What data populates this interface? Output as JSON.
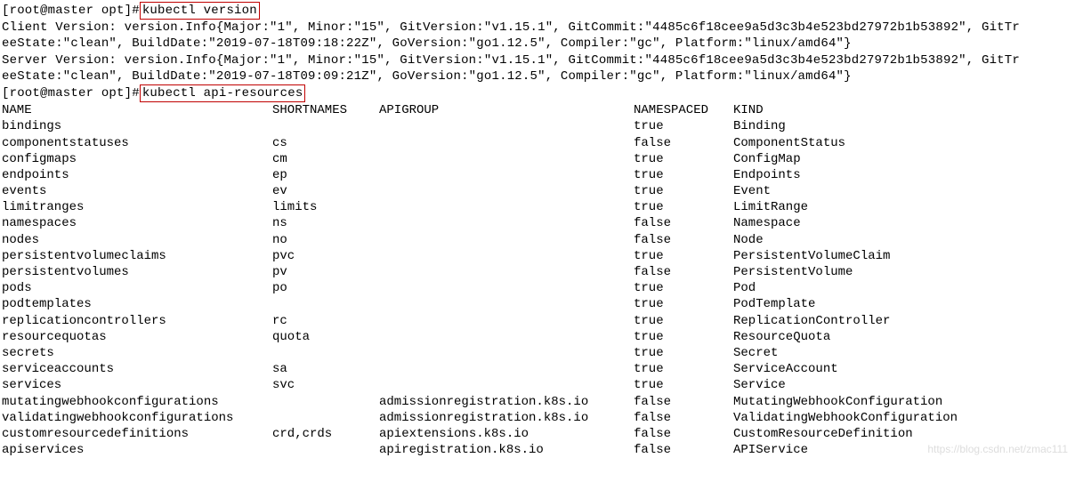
{
  "prompt1": {
    "prefix": "[root@master opt]#",
    "command": "kubectl version"
  },
  "version_output": [
    "Client Version: version.Info{Major:\"1\", Minor:\"15\", GitVersion:\"v1.15.1\", GitCommit:\"4485c6f18cee9a5d3c3b4e523bd27972b1b53892\", GitTr",
    "eeState:\"clean\", BuildDate:\"2019-07-18T09:18:22Z\", GoVersion:\"go1.12.5\", Compiler:\"gc\", Platform:\"linux/amd64\"}",
    "Server Version: version.Info{Major:\"1\", Minor:\"15\", GitVersion:\"v1.15.1\", GitCommit:\"4485c6f18cee9a5d3c3b4e523bd27972b1b53892\", GitTr",
    "eeState:\"clean\", BuildDate:\"2019-07-18T09:09:21Z\", GoVersion:\"go1.12.5\", Compiler:\"gc\", Platform:\"linux/amd64\"}"
  ],
  "prompt2": {
    "prefix": "[root@master opt]#",
    "command": "kubectl api-resources"
  },
  "table": {
    "headers": {
      "name": "NAME",
      "shortnames": "SHORTNAMES",
      "apigroup": "APIGROUP",
      "namespaced": "NAMESPACED",
      "kind": "KIND"
    },
    "rows": [
      {
        "name": "bindings",
        "short": "",
        "apigroup": "",
        "namespaced": "true",
        "kind": "Binding"
      },
      {
        "name": "componentstatuses",
        "short": "cs",
        "apigroup": "",
        "namespaced": "false",
        "kind": "ComponentStatus"
      },
      {
        "name": "configmaps",
        "short": "cm",
        "apigroup": "",
        "namespaced": "true",
        "kind": "ConfigMap"
      },
      {
        "name": "endpoints",
        "short": "ep",
        "apigroup": "",
        "namespaced": "true",
        "kind": "Endpoints"
      },
      {
        "name": "events",
        "short": "ev",
        "apigroup": "",
        "namespaced": "true",
        "kind": "Event"
      },
      {
        "name": "limitranges",
        "short": "limits",
        "apigroup": "",
        "namespaced": "true",
        "kind": "LimitRange"
      },
      {
        "name": "namespaces",
        "short": "ns",
        "apigroup": "",
        "namespaced": "false",
        "kind": "Namespace"
      },
      {
        "name": "nodes",
        "short": "no",
        "apigroup": "",
        "namespaced": "false",
        "kind": "Node"
      },
      {
        "name": "persistentvolumeclaims",
        "short": "pvc",
        "apigroup": "",
        "namespaced": "true",
        "kind": "PersistentVolumeClaim"
      },
      {
        "name": "persistentvolumes",
        "short": "pv",
        "apigroup": "",
        "namespaced": "false",
        "kind": "PersistentVolume"
      },
      {
        "name": "pods",
        "short": "po",
        "apigroup": "",
        "namespaced": "true",
        "kind": "Pod"
      },
      {
        "name": "podtemplates",
        "short": "",
        "apigroup": "",
        "namespaced": "true",
        "kind": "PodTemplate"
      },
      {
        "name": "replicationcontrollers",
        "short": "rc",
        "apigroup": "",
        "namespaced": "true",
        "kind": "ReplicationController"
      },
      {
        "name": "resourcequotas",
        "short": "quota",
        "apigroup": "",
        "namespaced": "true",
        "kind": "ResourceQuota"
      },
      {
        "name": "secrets",
        "short": "",
        "apigroup": "",
        "namespaced": "true",
        "kind": "Secret"
      },
      {
        "name": "serviceaccounts",
        "short": "sa",
        "apigroup": "",
        "namespaced": "true",
        "kind": "ServiceAccount"
      },
      {
        "name": "services",
        "short": "svc",
        "apigroup": "",
        "namespaced": "true",
        "kind": "Service"
      },
      {
        "name": "mutatingwebhookconfigurations",
        "short": "",
        "apigroup": "admissionregistration.k8s.io",
        "namespaced": "false",
        "kind": "MutatingWebhookConfiguration"
      },
      {
        "name": "validatingwebhookconfigurations",
        "short": "",
        "apigroup": "admissionregistration.k8s.io",
        "namespaced": "false",
        "kind": "ValidatingWebhookConfiguration"
      },
      {
        "name": "customresourcedefinitions",
        "short": "crd,crds",
        "apigroup": "apiextensions.k8s.io",
        "namespaced": "false",
        "kind": "CustomResourceDefinition"
      },
      {
        "name": "apiservices",
        "short": "",
        "apigroup": "apiregistration.k8s.io",
        "namespaced": "false",
        "kind": "APIService"
      }
    ]
  },
  "watermark": "https://blog.csdn.net/zmac111"
}
